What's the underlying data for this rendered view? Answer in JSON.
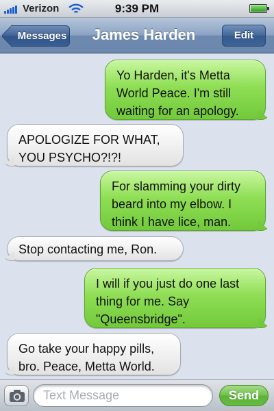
{
  "status_bar": {
    "carrier": "Verizon",
    "time": "9:39 PM",
    "signal_icon": "signal-bars-icon",
    "wifi_icon": "wifi-icon",
    "battery_icon": "battery-icon",
    "battery_level": 1.0
  },
  "nav_bar": {
    "back_label": "Messages",
    "title": "James Harden",
    "edit_label": "Edit"
  },
  "messages": [
    {
      "direction": "outgoing",
      "text": "Yo Harden, it's Metta\nWorld Peace. I'm still\nwaiting for an apology."
    },
    {
      "direction": "incoming",
      "text": "APOLOGIZE FOR WHAT,\nYOU PSYCHO?!?!"
    },
    {
      "direction": "outgoing",
      "text": "For slamming your dirty\nbeard into my elbow. I\nthink I have lice, man."
    },
    {
      "direction": "incoming",
      "text": "Stop contacting me, Ron."
    },
    {
      "direction": "outgoing",
      "text": "I will if you just do one last\nthing for me. Say\n\"Queensbridge\"."
    },
    {
      "direction": "incoming",
      "text": "Go take your happy pills,\nbro. Peace, Metta World."
    }
  ],
  "input_bar": {
    "camera_icon": "camera-icon",
    "placeholder": "Text Message",
    "send_label": "Send"
  },
  "colors": {
    "outgoing_bubble": "#8fde55",
    "incoming_bubble": "#f1f1f1",
    "background": "#dbe2ed",
    "nav_bar": "#8aa2c2"
  }
}
